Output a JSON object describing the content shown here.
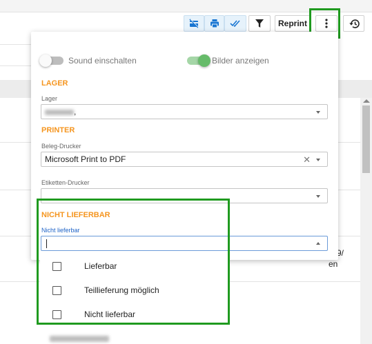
{
  "toolbar": {
    "reprint_label": "Reprint",
    "icons": [
      "card-off-icon",
      "print-icon",
      "done-all-icon",
      "filter-icon",
      "more-vert-icon",
      "history-icon"
    ]
  },
  "settings": {
    "sound_label": "Sound einschalten",
    "sound_on": false,
    "images_label": "Bilder anzeigen",
    "images_on": true,
    "lager": {
      "section": "LAGER",
      "label": "Lager",
      "value": ","
    },
    "printer": {
      "section": "PRINTER",
      "beleg_label": "Beleg-Drucker",
      "beleg_value": "Microsoft Print to PDF",
      "clear_glyph": "✕",
      "etiketten_label": "Etiketten-Drucker",
      "etiketten_value": ""
    },
    "nicht_lieferbar": {
      "section": "NICHT LIEFERBAR",
      "label": "Nicht lieferbar",
      "value": ""
    }
  },
  "dropdown_options": [
    {
      "label": "Lieferbar",
      "checked": false
    },
    {
      "label": "Teillieferung möglich",
      "checked": false
    },
    {
      "label": "Nicht lieferbar",
      "checked": false
    }
  ],
  "background": {
    "row_fragment_1": "9/",
    "row_fragment_2": "en"
  },
  "colors": {
    "section_orange": "#f5951f",
    "highlight_green": "#1f9a1f",
    "toggle_green": "#66bb6a",
    "active_blue": "#1e63c7"
  }
}
